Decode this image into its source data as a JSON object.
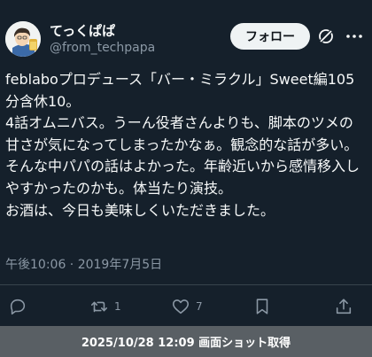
{
  "user": {
    "display_name": "てっくぱぱ",
    "handle": "@from_techpapa"
  },
  "follow_label": "フォロー",
  "tweet": {
    "text": "feblaboプロデュース「バー・ミラクル」Sweet編105分含休10。\n4話オムニバス。うーん役者さんよりも、脚本のツメの甘さが気になってしまったかなぁ。観念的な話が多い。\nそんな中パパの話はよかった。年齢近いから感情移入しやすかったのかも。体当たり演技。\nお酒は、今日も美味しくいただきました。",
    "timestamp": "午後10:06 · 2019年7月5日"
  },
  "actions": {
    "reply_icon": "reply-icon",
    "retweet_icon": "retweet-icon",
    "retweet_count": "1",
    "like_icon": "heart-icon",
    "like_count": "7",
    "bookmark_icon": "bookmark-icon",
    "share_icon": "share-icon"
  },
  "footer": {
    "caption": "2025/10/28 12:09 画面ショット取得"
  },
  "colors": {
    "background": "#15202b",
    "text": "#f7f9f9",
    "muted": "#8b98a5",
    "footer_bg": "#595f64"
  }
}
